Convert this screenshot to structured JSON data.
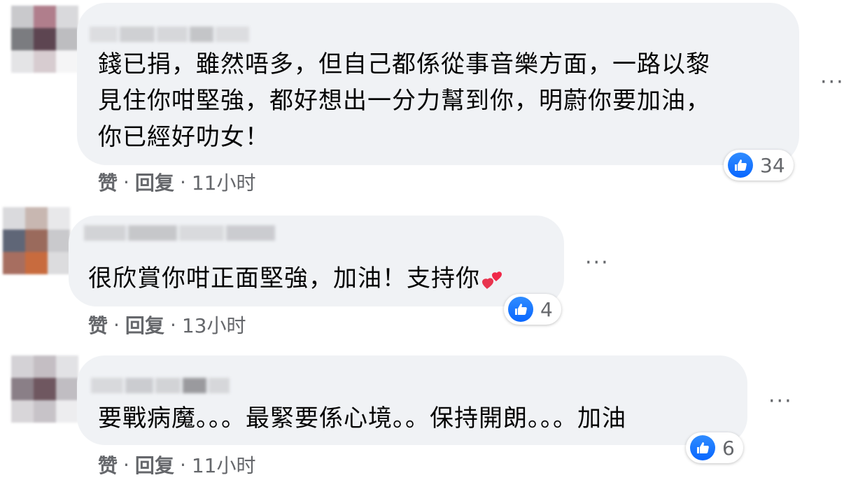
{
  "comments": [
    {
      "text": "錢已捐，雖然唔多，但自己都係從事音樂方面，一路以黎\n見住你咁堅強，都好想出一分力幫到你，明蔚你要加油，\n你已經好叻女！",
      "like_count": "34",
      "like_label": "赞",
      "reply_label": "回复",
      "time": "11小时",
      "separator": "·",
      "more": "···"
    },
    {
      "text": "很欣賞你咁正面堅強，加油！支持你",
      "emoji": "two-hearts-icon",
      "like_count": "4",
      "like_label": "赞",
      "reply_label": "回复",
      "time": "13小时",
      "separator": "·",
      "more": "···"
    },
    {
      "text": "要戰病魔。。。最緊要係心境。。保持開朗。。。加油",
      "like_count": "6",
      "like_label": "赞",
      "reply_label": "回复",
      "time": "11小时",
      "separator": "·",
      "more": "···"
    }
  ],
  "colors": {
    "bubble": "#f0f2f5",
    "like_blue": "#0866ff",
    "meta_gray": "#65676b",
    "heart_red": "#f02849"
  }
}
